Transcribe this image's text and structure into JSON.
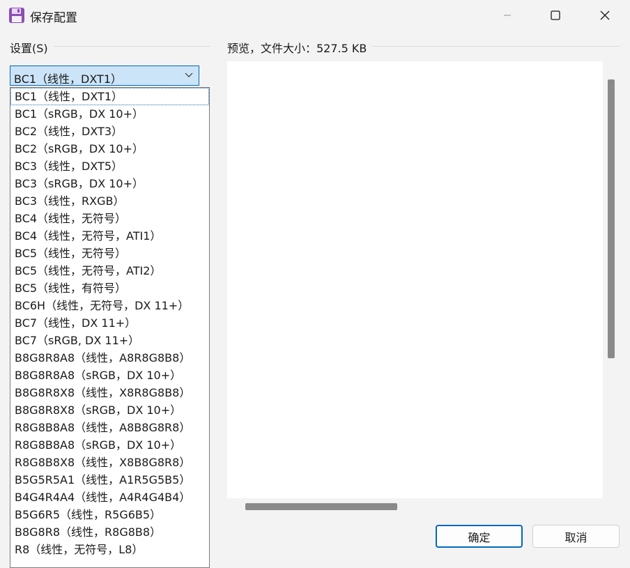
{
  "window": {
    "title": "保存配置",
    "icons": {
      "app": "floppy-disk-icon",
      "minimize": "minimize-icon",
      "maximize": "maximize-icon",
      "close": "close-icon"
    },
    "accent_color": "#0067c0"
  },
  "settings": {
    "group_label": "设置(S)",
    "selected": "BC1（线性，DXT1）",
    "options": [
      "BC1（线性，DXT1）",
      "BC1（sRGB，DX 10+）",
      "BC2（线性，DXT3）",
      "BC2（sRGB，DX 10+）",
      "BC3（线性，DXT5）",
      "BC3（sRGB，DX 10+）",
      "BC3（线性，RXGB）",
      "BC4（线性，无符号）",
      "BC4（线性，无符号，ATI1）",
      "BC5（线性，无符号）",
      "BC5（线性，无符号，ATI2）",
      "BC5（线性，有符号）",
      "BC6H（线性，无符号，DX 11+）",
      "BC7（线性，DX 11+）",
      "BC7（sRGB, DX 11+）",
      "B8G8R8A8（线性，A8R8G8B8）",
      "B8G8R8A8（sRGB，DX 10+）",
      "B8G8R8X8（线性，X8R8G8B8）",
      "B8G8R8X8（sRGB，DX 10+）",
      "R8G8B8A8（线性，A8B8G8R8）",
      "R8G8B8A8（sRGB，DX 10+）",
      "R8G8B8X8（线性，X8B8G8R8）",
      "B5G5R5A1（线性，A1R5G5B5）",
      "B4G4R4A4（线性，A4R4G4B4）",
      "B5G6R5（线性，R5G6B5）",
      "B8G8R8（线性，R8G8B8）",
      "R8（线性，无符号，L8）"
    ]
  },
  "preview": {
    "group_label": "预览，文件大小：527.5 KB"
  },
  "buttons": {
    "ok": "确定",
    "cancel": "取消"
  }
}
